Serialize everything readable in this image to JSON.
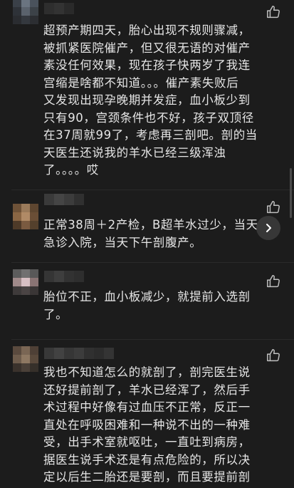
{
  "icons": {
    "like": "thumbs-up-icon",
    "next": "chevron-right-icon"
  },
  "colors": {
    "background": "#1c1c1c",
    "text": "#e6e6e6",
    "icon": "#bfbfbf"
  },
  "comments": [
    {
      "text": "超预产期四天，胎心出现不规则骤减，\n被抓紧医院催产，但又很无语的对催产\n素没任何效果，现在孩子快两岁了我连\n宫缩是啥都不知道。。。催产素失败后\n又发现出现孕晚期并发症，血小板少到\n只有90，宫颈条件也不好，孩子双顶径\n在37周就99了，考虑再三剖吧。剖的当\n天医生还说我的羊水已经三级浑浊\n了。。。。哎"
    },
    {
      "text": "正常38周＋2产检，B超羊水过少，当天\n急诊入院，当天下午剖腹产。"
    },
    {
      "text": "胎位不正，血小板减少，就提前入选剖\n了。"
    },
    {
      "text": "我也不知道怎么的就剖了，剖完医生说\n还好提前剖了，羊水已经浑了，然后手\n术过程中好像有过血压不正常，反正一\n直处在呼吸困难和一种说不出的一种难\n受，出手术室就呕吐，一直吐到病房，\n据医生说手术还是有点危险的，所以决\n定以后生二胎还是要剖，而且要提前剖"
    }
  ]
}
